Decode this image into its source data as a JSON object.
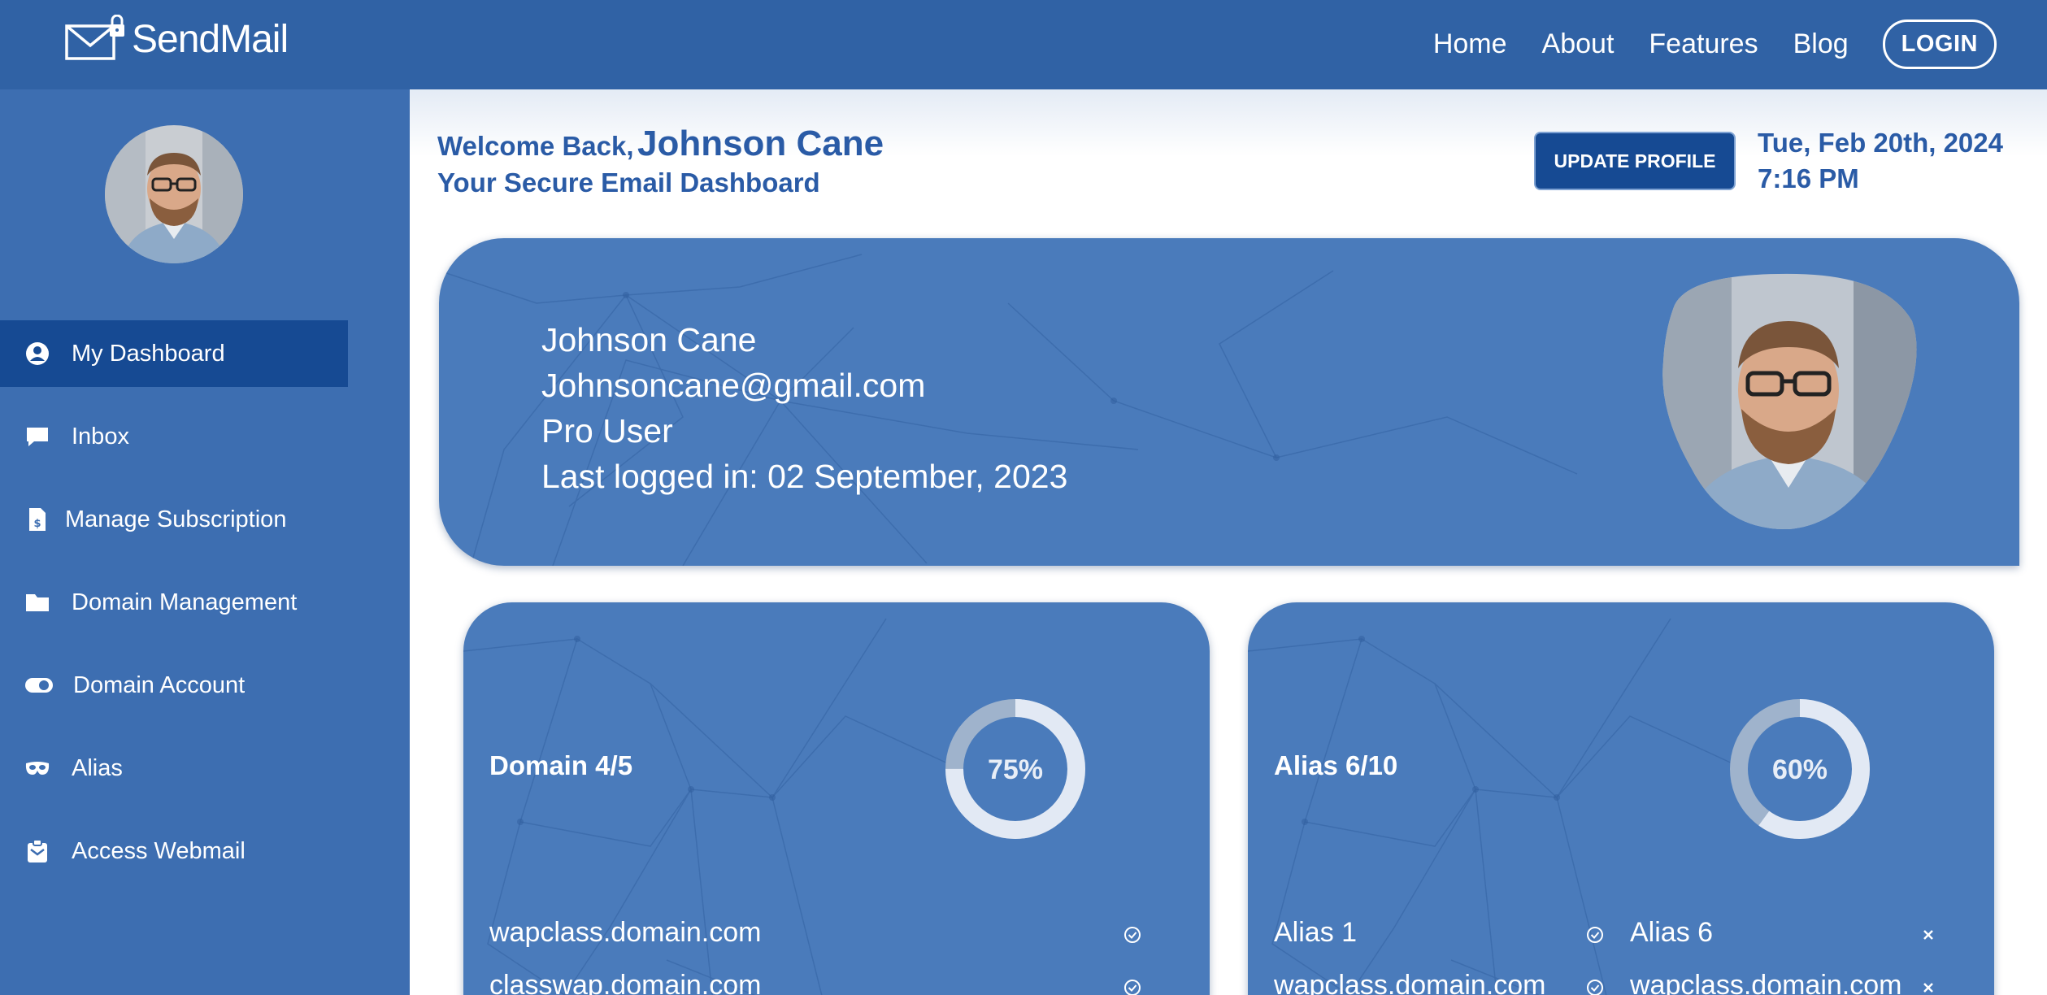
{
  "brand": {
    "name": "SendMail"
  },
  "nav": {
    "links": [
      "Home",
      "About",
      "Features",
      "Blog"
    ],
    "login": "LOGIN"
  },
  "sidebar": {
    "items": [
      {
        "label": "My Dashboard",
        "icon": "user-circle-icon",
        "active": true
      },
      {
        "label": "Inbox",
        "icon": "chat-bubble-icon"
      },
      {
        "label": "Manage Subscription",
        "icon": "invoice-dollar-icon"
      },
      {
        "label": "Domain Management",
        "icon": "folder-icon"
      },
      {
        "label": "Domain Account",
        "icon": "toggle-icon"
      },
      {
        "label": "Alias",
        "icon": "mask-icon"
      },
      {
        "label": "Access Webmail",
        "icon": "webmail-icon"
      }
    ]
  },
  "header": {
    "welcome_prefix": "Welcome Back,",
    "user_name": "Johnson Cane",
    "subtitle": "Your Secure Email Dashboard",
    "update_button": "UPDATE PROFILE",
    "date": "Tue, Feb 20th, 2024",
    "time": "7:16 PM"
  },
  "profile": {
    "name": "Johnson Cane",
    "email": "Johnsoncane@gmail.com",
    "plan": "Pro User",
    "last_login": "Last logged in: 02 September, 2023"
  },
  "domains": {
    "title": "Domain 4/5",
    "percent": 75,
    "percent_label": "75%",
    "items": [
      {
        "name": "wapclass.domain.com",
        "status": "check-circle-icon"
      },
      {
        "name": "classwap.domain.com",
        "status": "check-circle-icon"
      }
    ]
  },
  "aliases": {
    "title": "Alias 6/10",
    "percent": 60,
    "percent_label": "60%",
    "items": [
      {
        "name": "Alias 1",
        "status": "check-circle-icon"
      },
      {
        "name": "Alias 6",
        "status": "close-icon"
      },
      {
        "name": "wapclass.domain.com",
        "status": "check-circle-icon"
      },
      {
        "name": "wapclass.domain.com",
        "status": "close-icon"
      }
    ]
  },
  "colors": {
    "navbar": "#3062a5",
    "sidebar": "#3d6eb1",
    "sidebar_active": "#164a93",
    "card": "#4a7bbb",
    "accent_text": "#2a5ba6",
    "donut_track": "#e2e9f4",
    "donut_fill": "#9fb3cc"
  }
}
